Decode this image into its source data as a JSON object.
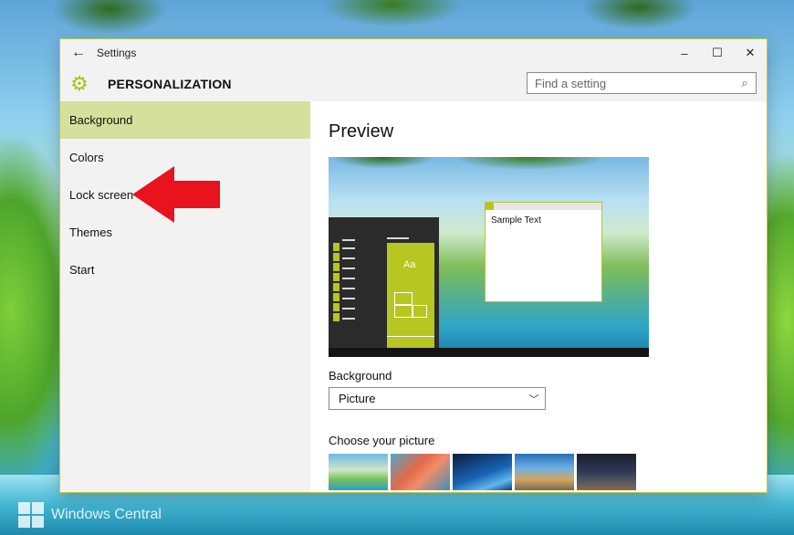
{
  "window": {
    "title": "Settings",
    "back_icon": "back-arrow-icon",
    "controls": {
      "minimize": "–",
      "maximize": "☐",
      "close": "✕"
    }
  },
  "header": {
    "icon": "gear-icon",
    "title": "PERSONALIZATION",
    "search_placeholder": "Find a setting",
    "search_icon": "search-icon"
  },
  "sidebar": {
    "items": [
      {
        "label": "Background",
        "active": true
      },
      {
        "label": "Colors",
        "active": false
      },
      {
        "label": "Lock screen",
        "active": false
      },
      {
        "label": "Themes",
        "active": false
      },
      {
        "label": "Start",
        "active": false
      }
    ]
  },
  "main": {
    "preview_title": "Preview",
    "preview_tile_text": "Aa",
    "preview_sample_text": "Sample Text",
    "background_label": "Background",
    "background_value": "Picture",
    "choose_picture_label": "Choose your picture"
  },
  "watermark": {
    "text": "Windows Central"
  },
  "colors": {
    "accent": "#b7c621",
    "selected_nav": "#d4e09b",
    "annotation_arrow": "#e8131c"
  }
}
